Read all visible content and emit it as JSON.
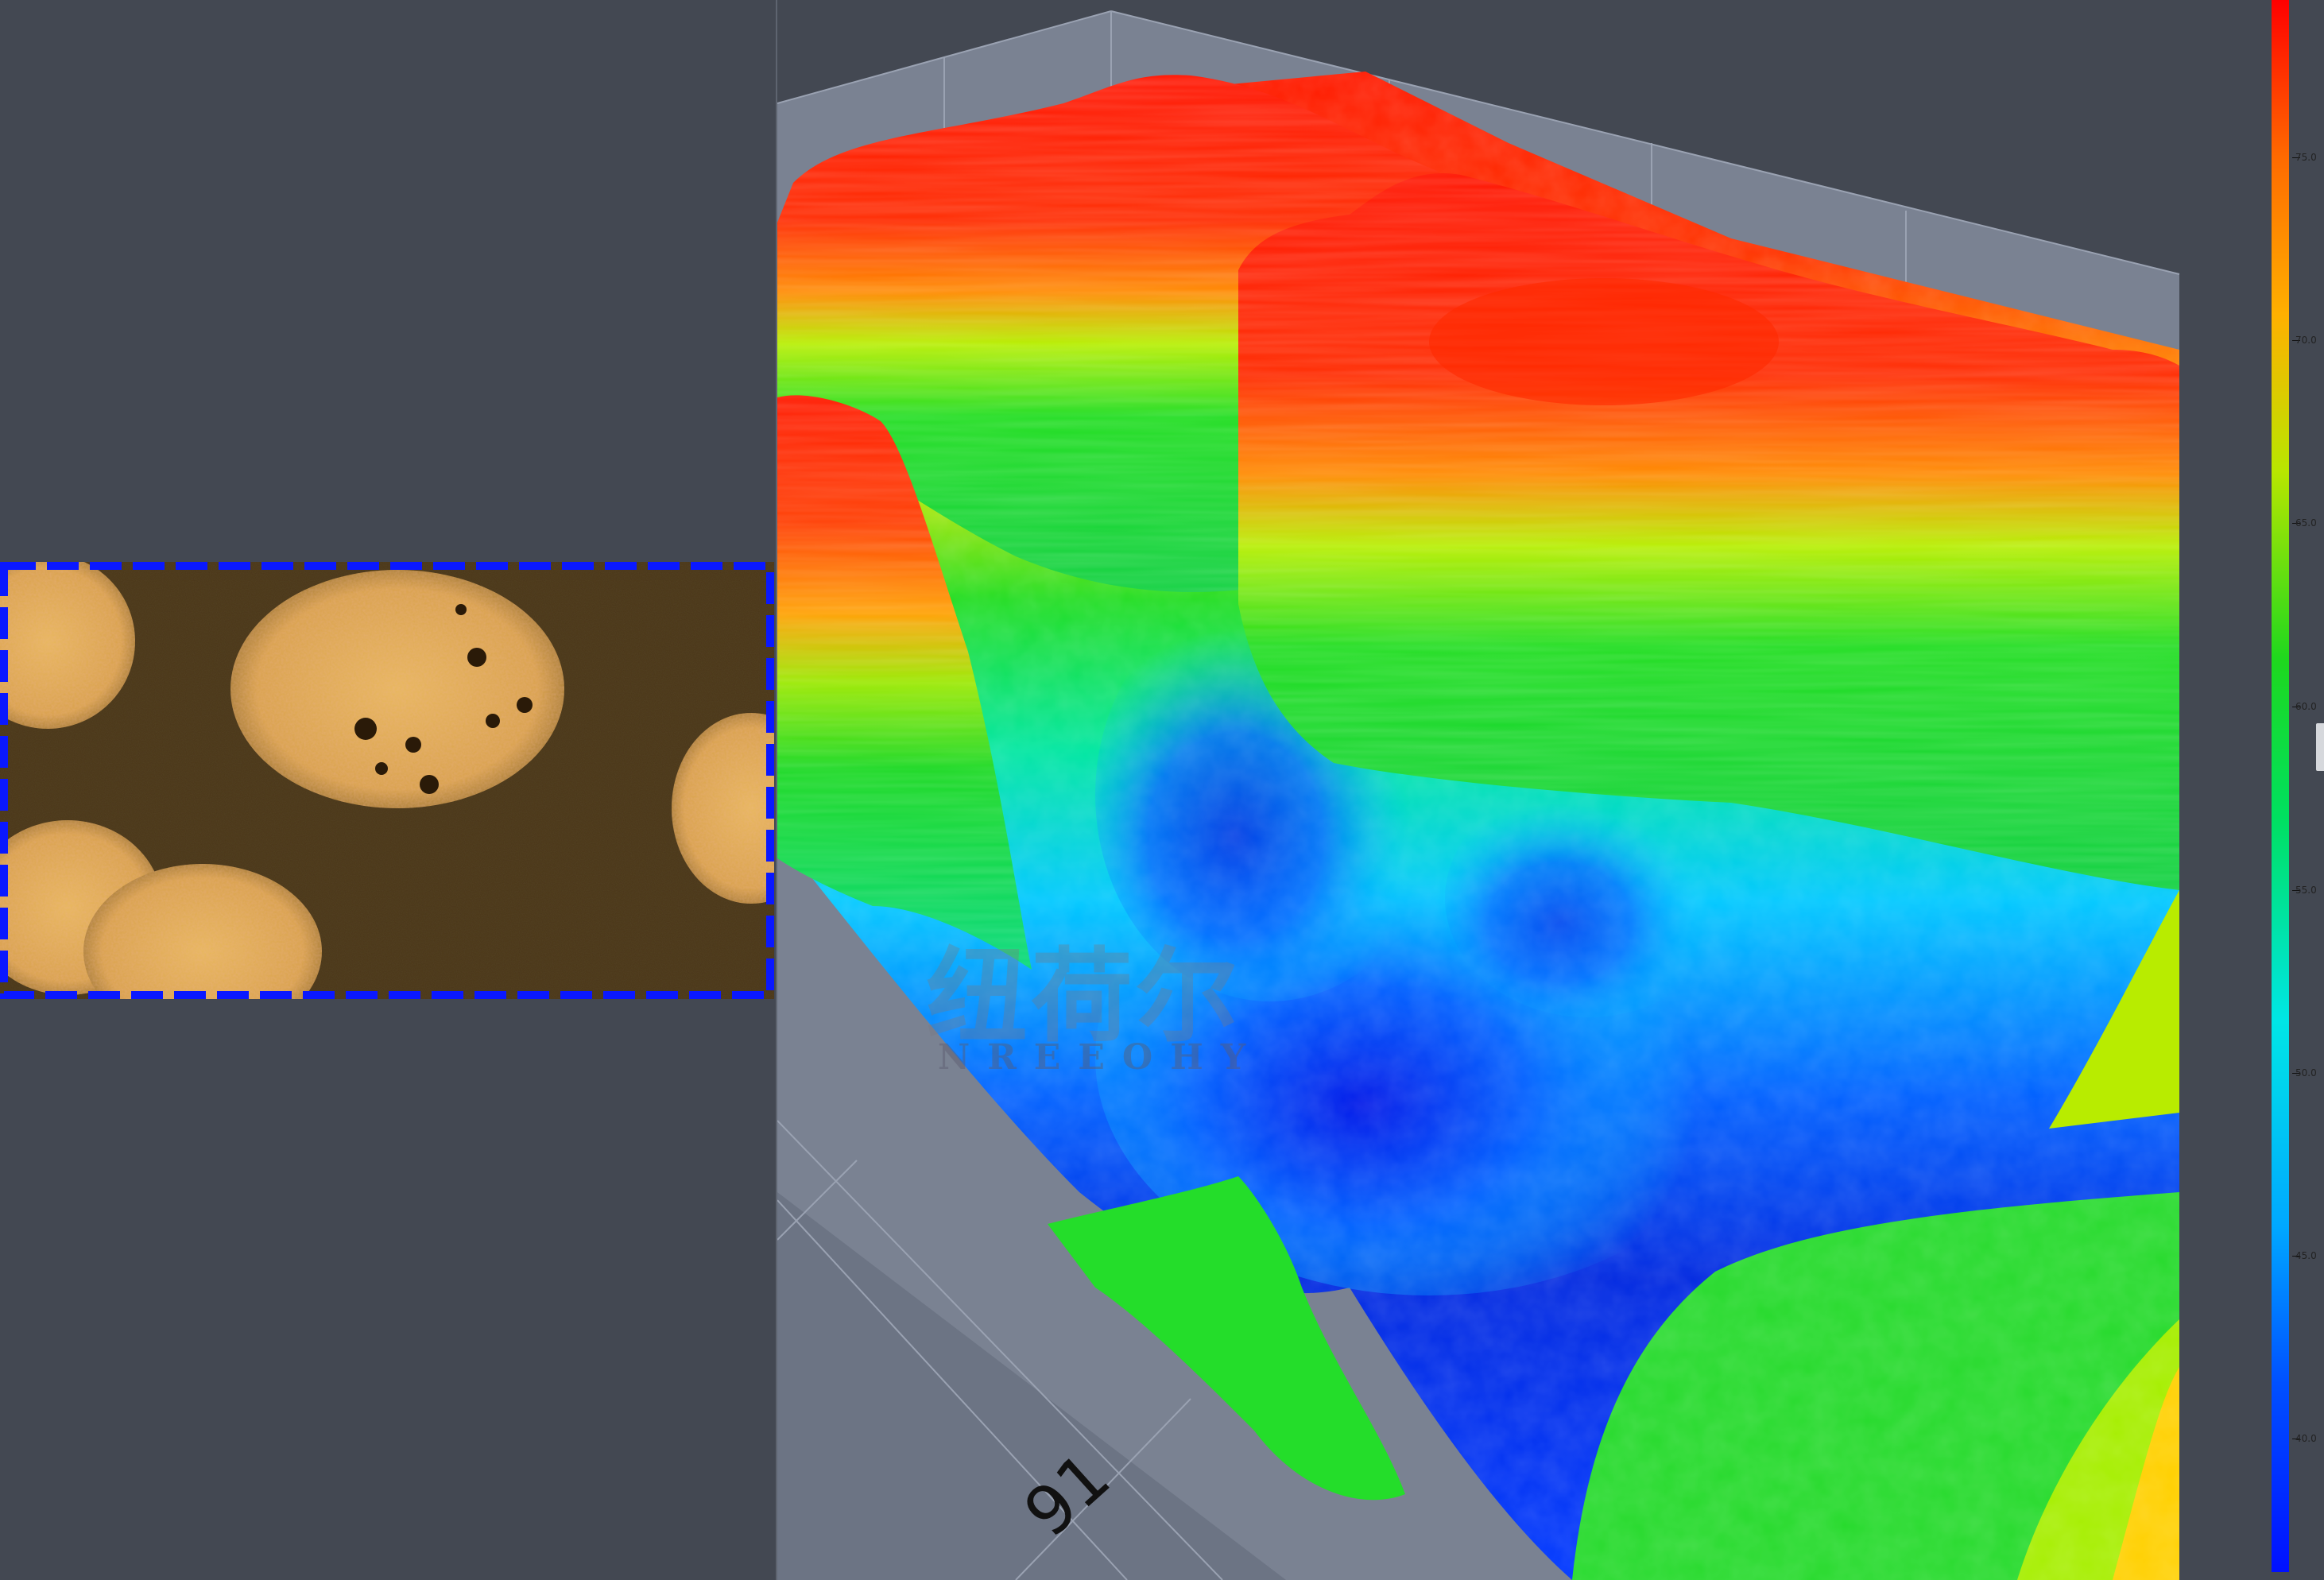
{
  "viewport": {
    "axis_tick_label": "91",
    "watermark": {
      "chinese": "纽荷尔",
      "latin": "NREEOHY"
    }
  },
  "colorbar": {
    "ticks": [
      "75.0",
      "70.0",
      "65.0",
      "60.0",
      "55.0",
      "50.0",
      "45.0",
      "40.0"
    ],
    "colors": {
      "max": "#ff0000",
      "mid": "#1ed81e",
      "min": "#0010ff"
    }
  },
  "preview": {
    "selection_border_color": "#0a18ff"
  },
  "theme": {
    "background": "#434852",
    "plot_walls": "#7a8292"
  }
}
